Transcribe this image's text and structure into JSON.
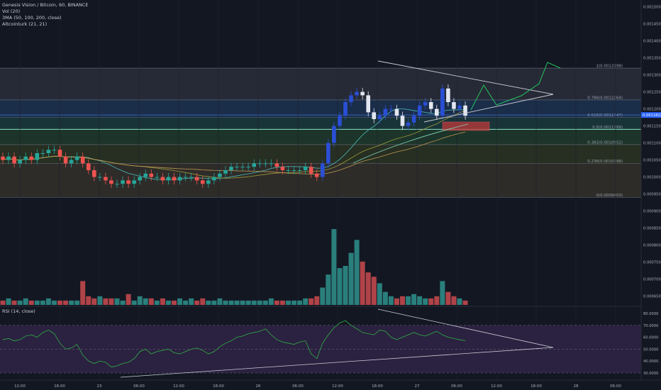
{
  "header": {
    "symbol": "Genesis Vision / Bitcoin, 60, BINANCE",
    "volume": "Vol (20)",
    "sma": "3MA (50, 100, 200, close)",
    "ichimoku": "Altcointurk (21, 21)",
    "rsi": "RSI (14, close)"
  },
  "price_axis": {
    "labels": [
      "0.0015000",
      "0.0014500",
      "0.0014000",
      "0.0013500",
      "0.0013000",
      "0.0012500",
      "0.0012000",
      "0.0011500",
      "0.0011000",
      "0.0010500",
      "0.0010000",
      "0.0009500",
      "0.0009000",
      "0.0008500",
      "0.0008000",
      "0.0007500",
      "0.0007000",
      "0.0006500"
    ],
    "current_price_label": "0.0011822"
  },
  "rsi_axis": {
    "labels": [
      "80.0000",
      "70.0000",
      "60.0000",
      "50.0000",
      "40.0000",
      "30.0000"
    ]
  },
  "time_axis": {
    "labels": [
      "12:00",
      "18:00",
      "23",
      "06:00",
      "12:00",
      "18:00",
      "26",
      "06:00",
      "12:00",
      "18:00",
      "27",
      "06:00",
      "12:00",
      "18:00",
      "28",
      "06:00"
    ]
  },
  "fib_levels": [
    {
      "label": "1(0.0013198)",
      "price": 0.0013198,
      "zone": "#2a2e39"
    },
    {
      "label": "0.786(0.0012264)",
      "price": 0.0012264,
      "zone": "#1c3150"
    },
    {
      "label": "0.618(0.0011747)",
      "price": 0.0011747,
      "zone": "#1b3a3c"
    },
    {
      "label": "0.5(0.0011399)",
      "price": 0.0011399,
      "zone": "#1f3a2a"
    },
    {
      "label": "0.382(0.0010952)",
      "price": 0.0010952,
      "zone": "#2a3422"
    },
    {
      "label": "0.236(0.0010398)",
      "price": 0.0010398,
      "zone": "#34302a"
    },
    {
      "label": "0(0.0009403)",
      "price": 0.0009403,
      "zone": "#3a1f27"
    }
  ],
  "colors": {
    "up_candle": "#2a4fd6",
    "down_candle": "#e2e6f0",
    "early_up": "#26a69a",
    "early_down": "#ef5350",
    "vol_up": "#2e8b86",
    "vol_down": "#c2484c",
    "projection": "#22c55e",
    "rsi_line": "#2ea043",
    "rsi_bg": "#2b2140",
    "box": "#c0393b"
  },
  "chart_data": {
    "type": "candlestick",
    "price_start": 0.00106,
    "price_closes": [
      0.00105,
      0.00106,
      0.00104,
      0.00105,
      0.00106,
      0.00105,
      0.00107,
      0.00107,
      0.00108,
      0.00108,
      0.00106,
      0.00104,
      0.00105,
      0.00106,
      0.00104,
      0.00102,
      0.001,
      0.001,
      0.00099,
      0.00098,
      0.00098,
      0.00099,
      0.00098,
      0.00099,
      0.001,
      0.00101,
      0.001,
      0.001,
      0.00099,
      0.001,
      0.00099,
      0.001,
      0.001,
      0.001,
      0.00099,
      0.00098,
      0.00099,
      0.001,
      0.00101,
      0.00102,
      0.00103,
      0.00103,
      0.00103,
      0.00103,
      0.00104,
      0.00104,
      0.00104,
      0.00104,
      0.00103,
      0.00102,
      0.00102,
      0.00102,
      0.00102,
      0.00103,
      0.00101,
      0.001,
      0.00104,
      0.0011,
      0.00115,
      0.00118,
      0.00122,
      0.00124,
      0.00125,
      0.00124,
      0.00119,
      0.00117,
      0.00118,
      0.0012,
      0.0012,
      0.00118,
      0.00115,
      0.00116,
      0.00118,
      0.00121,
      0.00122,
      0.0012,
      0.00118,
      0.00126,
      0.00122,
      0.0012,
      0.00121,
      0.00118
    ],
    "volumes": [
      2,
      3,
      2,
      2,
      3,
      2,
      2,
      2,
      3,
      2,
      2,
      2,
      2,
      2,
      11,
      4,
      3,
      4,
      3,
      3,
      3,
      2,
      5,
      2,
      4,
      3,
      3,
      2,
      3,
      2,
      2,
      3,
      2,
      3,
      2,
      3,
      2,
      2,
      3,
      2,
      2,
      2,
      2,
      2,
      2,
      2,
      2,
      3,
      2,
      2,
      2,
      2,
      2,
      3,
      3,
      4,
      8,
      14,
      35,
      17,
      18,
      24,
      30,
      20,
      15,
      13,
      10,
      6,
      4,
      3,
      4,
      4,
      5,
      4,
      3,
      3,
      4,
      11,
      6,
      4,
      3,
      2
    ],
    "rsi": [
      58,
      59,
      57,
      58,
      61,
      62,
      60,
      64,
      66,
      63,
      55,
      50,
      51,
      54,
      45,
      40,
      38,
      40,
      39,
      35,
      36,
      38,
      39,
      42,
      48,
      50,
      46,
      48,
      49,
      50,
      47,
      46,
      48,
      50,
      51,
      49,
      46,
      48,
      52,
      55,
      57,
      60,
      61,
      63,
      64,
      65,
      67,
      62,
      58,
      56,
      55,
      54,
      56,
      57,
      46,
      42,
      55,
      62,
      68,
      72,
      74,
      70,
      67,
      64,
      63,
      62,
      66,
      65,
      60,
      58,
      60,
      62,
      64,
      62,
      61,
      63,
      65,
      62,
      60,
      59,
      58,
      57
    ],
    "fib_range": [
      0.0009403,
      0.0013198
    ],
    "price_range": [
      0.00062,
      0.00152
    ],
    "rsi_range": [
      30,
      80
    ]
  }
}
